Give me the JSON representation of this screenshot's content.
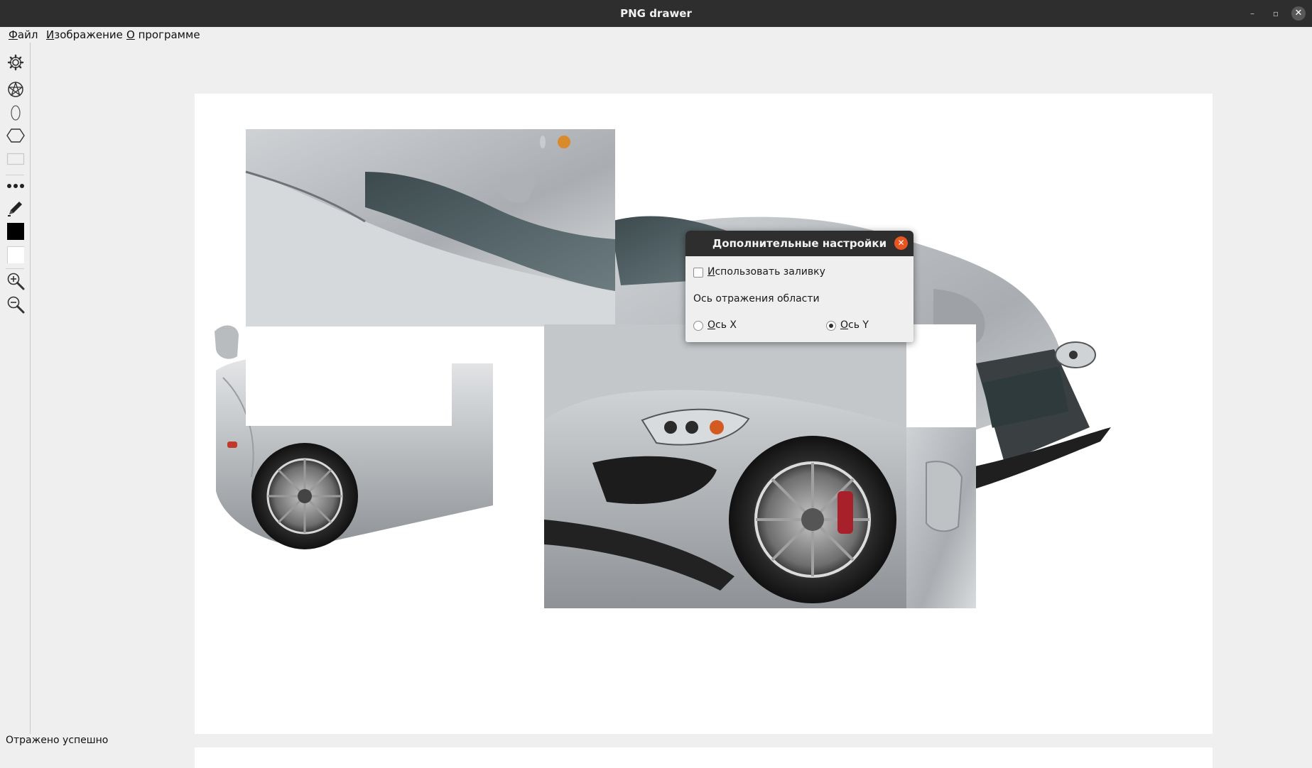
{
  "window": {
    "title": "PNG drawer",
    "minimize_glyph": "–",
    "maximize_glyph": "▫",
    "close_glyph": "✕"
  },
  "menu": {
    "file": {
      "mnemonic": "Ф",
      "rest": "айл"
    },
    "image": {
      "mnemonic": "И",
      "rest": "зображение"
    },
    "about": {
      "mnemonic": "О",
      "rest": " программе"
    }
  },
  "toolbar": {
    "tools": [
      {
        "icon": "gear-icon"
      },
      {
        "icon": "pentagram-icon"
      },
      {
        "icon": "ellipse-icon"
      },
      {
        "icon": "hexagon-icon"
      },
      {
        "icon": "rectangle-icon"
      },
      {
        "icon": "line-style-dots-icon"
      },
      {
        "icon": "pencil-icon"
      },
      {
        "icon": "primary-color-swatch",
        "color": "#000000"
      },
      {
        "icon": "secondary-color-swatch",
        "color": "#ffffff"
      },
      {
        "icon": "zoom-in-icon"
      },
      {
        "icon": "zoom-out-icon"
      }
    ]
  },
  "canvas": {
    "content": "car-image-with-mirrored-regions"
  },
  "dialog": {
    "title": "Дополнительные настройки",
    "close_glyph": "✕",
    "use_fill": {
      "mnemonic": "И",
      "rest": "спользовать заливку",
      "checked": false
    },
    "axis_label": "Ось отражения области",
    "axis_x": {
      "mnemonic": "О",
      "rest": "сь X",
      "checked": false
    },
    "axis_y": {
      "mnemonic": "О",
      "rest": "сь Y",
      "checked": true
    }
  },
  "status": {
    "text": "Отражено успешно"
  },
  "colors": {
    "titlebar": "#2e2e2e",
    "window_bg": "#efefef",
    "accent_close": "#e95420"
  }
}
